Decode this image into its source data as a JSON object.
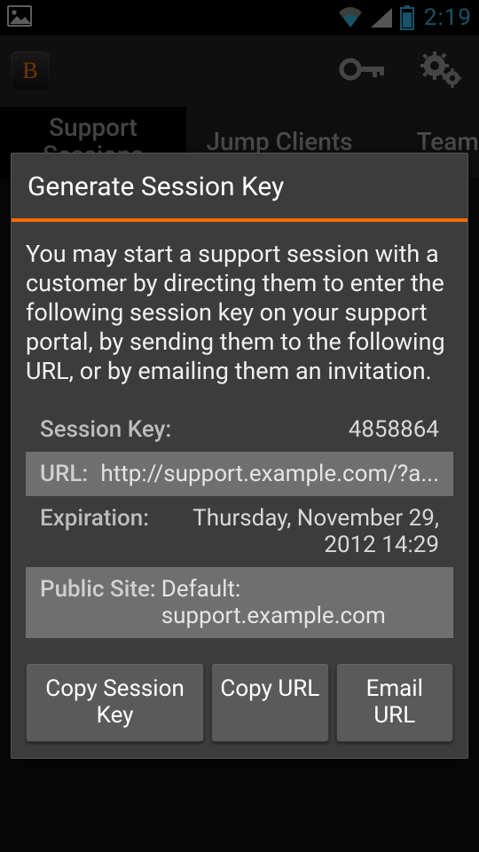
{
  "status_bar": {
    "clock": "2:19"
  },
  "toolbar": {
    "app_letter": "B"
  },
  "tabs": {
    "items": [
      {
        "label": "Support\nSessions",
        "active": true
      },
      {
        "label": "Jump Clients",
        "active": false
      },
      {
        "label": "Team Ch",
        "active": false
      }
    ]
  },
  "dialog": {
    "title": "Generate Session Key",
    "description": "You may start a support session with a customer by directing them to enter the following session key on your support portal, by sending them to the following URL, or by emailing them an invitation.",
    "rows": {
      "session_key": {
        "label": "Session Key:",
        "value": "4858864"
      },
      "url": {
        "label": "URL:",
        "value": "http://support.example.com/?a..."
      },
      "expiration": {
        "label": "Expiration:",
        "value": "Thursday, November 29, 2012 14:29"
      },
      "public_site": {
        "label": "Public Site:",
        "value": "Default: support.example.com"
      }
    },
    "buttons": {
      "copy_key": "Copy Session Key",
      "copy_url": "Copy URL",
      "email_url": "Email URL"
    }
  }
}
